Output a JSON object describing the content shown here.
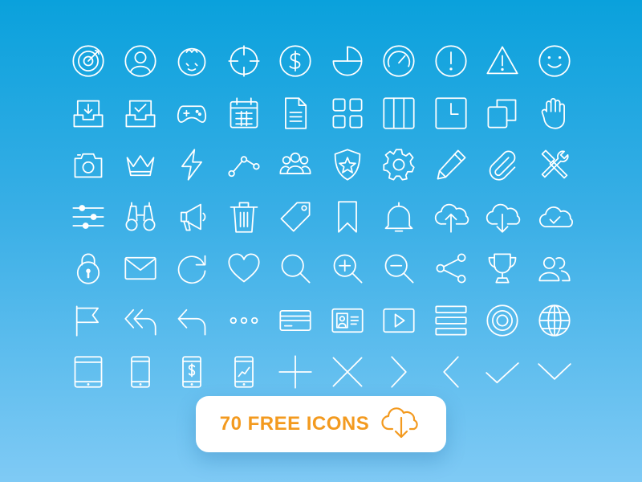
{
  "cta": {
    "label": "70 FREE ICONS",
    "icon": "cloud-download-icon"
  },
  "colors": {
    "background_top": "#0aa1dc",
    "background_bottom": "#7fcaf5",
    "icon_stroke": "#ffffff",
    "cta_text": "#f39a1f",
    "cta_background": "#ffffff"
  },
  "icons": [
    "target-icon",
    "user-circle-icon",
    "face-blush-icon",
    "crosshair-icon",
    "dollar-circle-icon",
    "pie-chart-icon",
    "gauge-icon",
    "alert-circle-icon",
    "warning-triangle-icon",
    "smile-icon",
    "inbox-download-icon",
    "inbox-check-icon",
    "gamepad-icon",
    "calendar-icon",
    "document-icon",
    "grid-icon",
    "columns-icon",
    "clock-icon",
    "copy-icon",
    "hand-icon",
    "camera-icon",
    "crown-icon",
    "lightning-icon",
    "nodes-link-icon",
    "group-icon",
    "shield-star-icon",
    "gear-icon",
    "pencil-icon",
    "paperclip-icon",
    "tools-icon",
    "sliders-icon",
    "binoculars-icon",
    "megaphone-icon",
    "trash-icon",
    "tag-icon",
    "bookmark-icon",
    "bell-icon",
    "cloud-upload-icon",
    "cloud-download-icon",
    "cloud-check-icon",
    "lock-icon",
    "mail-icon",
    "refresh-icon",
    "heart-icon",
    "search-icon",
    "zoom-in-icon",
    "zoom-out-icon",
    "share-icon",
    "trophy-icon",
    "users-icon",
    "flag-icon",
    "reply-all-icon",
    "reply-icon",
    "more-dots-icon",
    "credit-card-icon",
    "id-card-icon",
    "video-play-icon",
    "menu-icon",
    "radio-target-icon",
    "globe-icon",
    "tablet-icon",
    "phone-icon",
    "phone-dollar-icon",
    "phone-chart-icon",
    "plus-icon",
    "close-icon",
    "chevron-right-icon",
    "chevron-left-icon",
    "check-icon",
    "chevron-down-icon"
  ]
}
